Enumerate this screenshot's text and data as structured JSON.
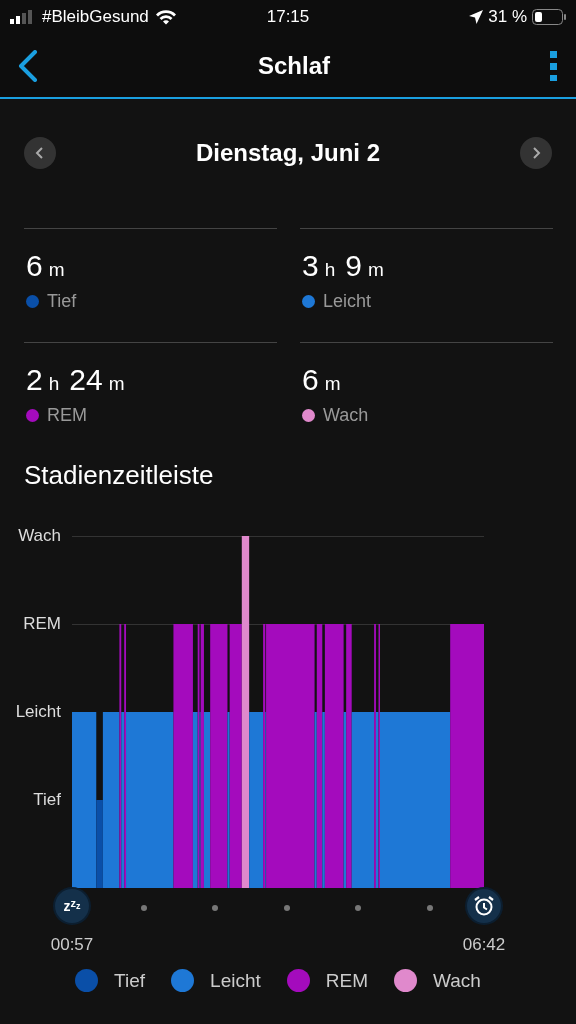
{
  "status_bar": {
    "carrier": "#BleibGesund",
    "time": "17:15",
    "battery_percent": "31 %"
  },
  "nav": {
    "title": "Schlaf"
  },
  "date_nav": {
    "date": "Dienstag, Juni 2"
  },
  "stats": [
    {
      "value": [
        {
          "number": "6",
          "unit": "m"
        }
      ],
      "label": "Tief",
      "color": "#0a4fa8"
    },
    {
      "value": [
        {
          "number": "3",
          "unit": "h"
        },
        {
          "number": "9",
          "unit": "m"
        }
      ],
      "label": "Leicht",
      "color": "#1e78d6"
    },
    {
      "value": [
        {
          "number": "2",
          "unit": "h"
        },
        {
          "number": "24",
          "unit": "m"
        }
      ],
      "label": "REM",
      "color": "#a40bbd"
    },
    {
      "value": [
        {
          "number": "6",
          "unit": "m"
        }
      ],
      "label": "Wach",
      "color": "#e089cc"
    }
  ],
  "timeline": {
    "title": "Stadienzeitleiste",
    "y_labels": [
      "Wach",
      "REM",
      "Leicht",
      "Tief"
    ],
    "start_time": "00:57",
    "end_time": "06:42",
    "sleep_icon_text": "zzz",
    "legend": [
      {
        "label": "Tief",
        "color": "#0a4fa8"
      },
      {
        "label": "Leicht",
        "color": "#1e78d6"
      },
      {
        "label": "REM",
        "color": "#a40bbd"
      },
      {
        "label": "Wach",
        "color": "#e089cc"
      }
    ]
  }
}
